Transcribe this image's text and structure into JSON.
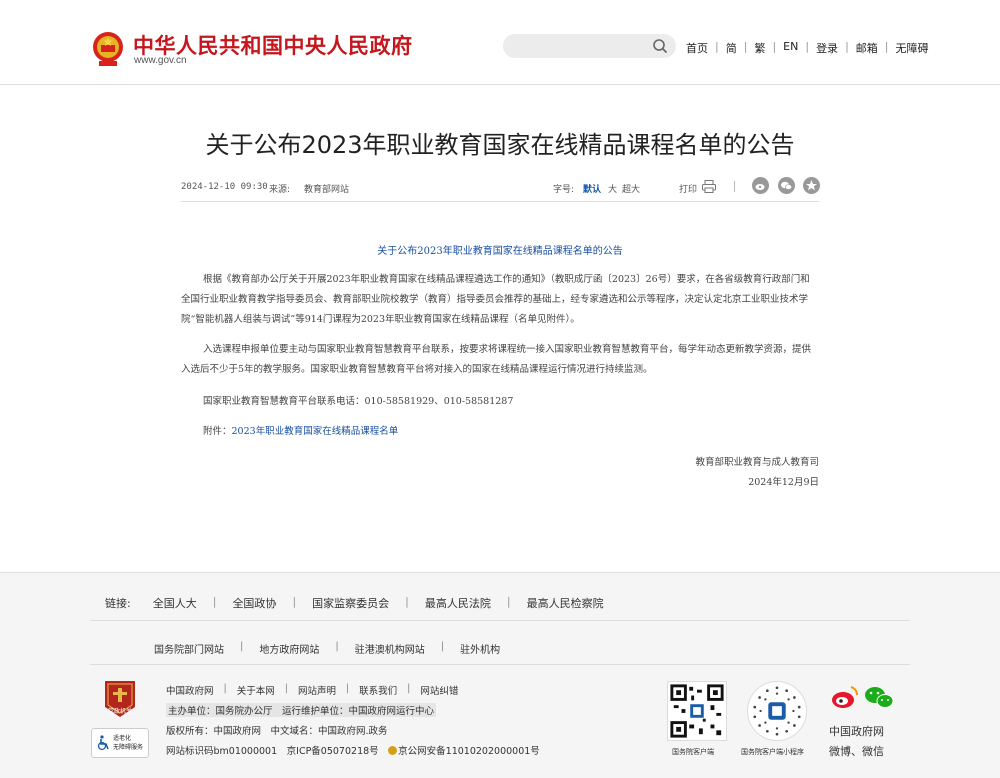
{
  "header": {
    "site_name": "中华人民共和国中央人民政府",
    "site_url": "www.gov.cn",
    "search_placeholder": "",
    "nav": [
      "首页",
      "简",
      "繁",
      "EN",
      "登录",
      "邮箱",
      "无障碍"
    ]
  },
  "article": {
    "title": "关于公布2023年职业教育国家在线精品课程名单的公告",
    "date": "2024-12-10 09:30",
    "source_label": "来源:",
    "source": "教育部网站",
    "font_size_label": "字号:",
    "font_sizes": [
      "默认",
      "大",
      "超大"
    ],
    "print_label": "打印",
    "inner_title": "关于公布2023年职业教育国家在线精品课程名单的公告",
    "p1": "根据《教育部办公厅关于开展2023年职业教育国家在线精品课程遴选工作的通知》（教职成厅函〔2023〕26号）要求，在各省级教育行政部门和全国行业职业教育教学指导委员会、教育部职业院校教学（教育）指导委员会推荐的基础上，经专家遴选和公示等程序，决定认定北京工业职业技术学院“智能机器人组装与调试”等914门课程为2023年职业教育国家在线精品课程（名单见附件）。",
    "p2": "入选课程申报单位要主动与国家职业教育智慧教育平台联系，按要求将课程统一接入国家职业教育智慧教育平台，每学年动态更新教学资源，提供入选后不少于5年的教学服务。国家职业教育智慧教育平台将对接入的国家在线精品课程运行情况进行持续监测。",
    "p3": "国家职业教育智慧教育平台联系电话：010-58581929、010-58581287",
    "attach_label": "附件：",
    "attach_link": "2023年职业教育国家在线精品课程名单",
    "signer": "教育部职业教育与成人教育司",
    "sign_date": "2024年12月9日"
  },
  "footer": {
    "links_label": "链接:",
    "links": [
      "全国人大",
      "全国政协",
      "国家监察委员会",
      "最高人民法院",
      "最高人民检察院"
    ],
    "links2": [
      "国务院部门网站",
      "地方政府网站",
      "驻港澳机构网站",
      "驻外机构"
    ],
    "badge_text": "党政机关",
    "elder_text_1": "适老化",
    "elder_text_2": "无障碍服务",
    "info_links": [
      "中国政府网",
      "关于本网",
      "网站声明",
      "联系我们",
      "网站纠错"
    ],
    "sponsor": "主办单位：国务院办公厅　运行维护单位：中国政府网运行中心",
    "copyright": "版权所有：中国政府网　中文域名：中国政府网.政务",
    "icp": "网站标识码bm01000001　京ICP备05070218号",
    "police": "京公网安备11010202000001号",
    "qr1_caption": "国务院客户端",
    "qr2_caption": "国务院客户端小程序",
    "social_caption_1": "中国政府网",
    "social_caption_2": "微博、微信"
  }
}
